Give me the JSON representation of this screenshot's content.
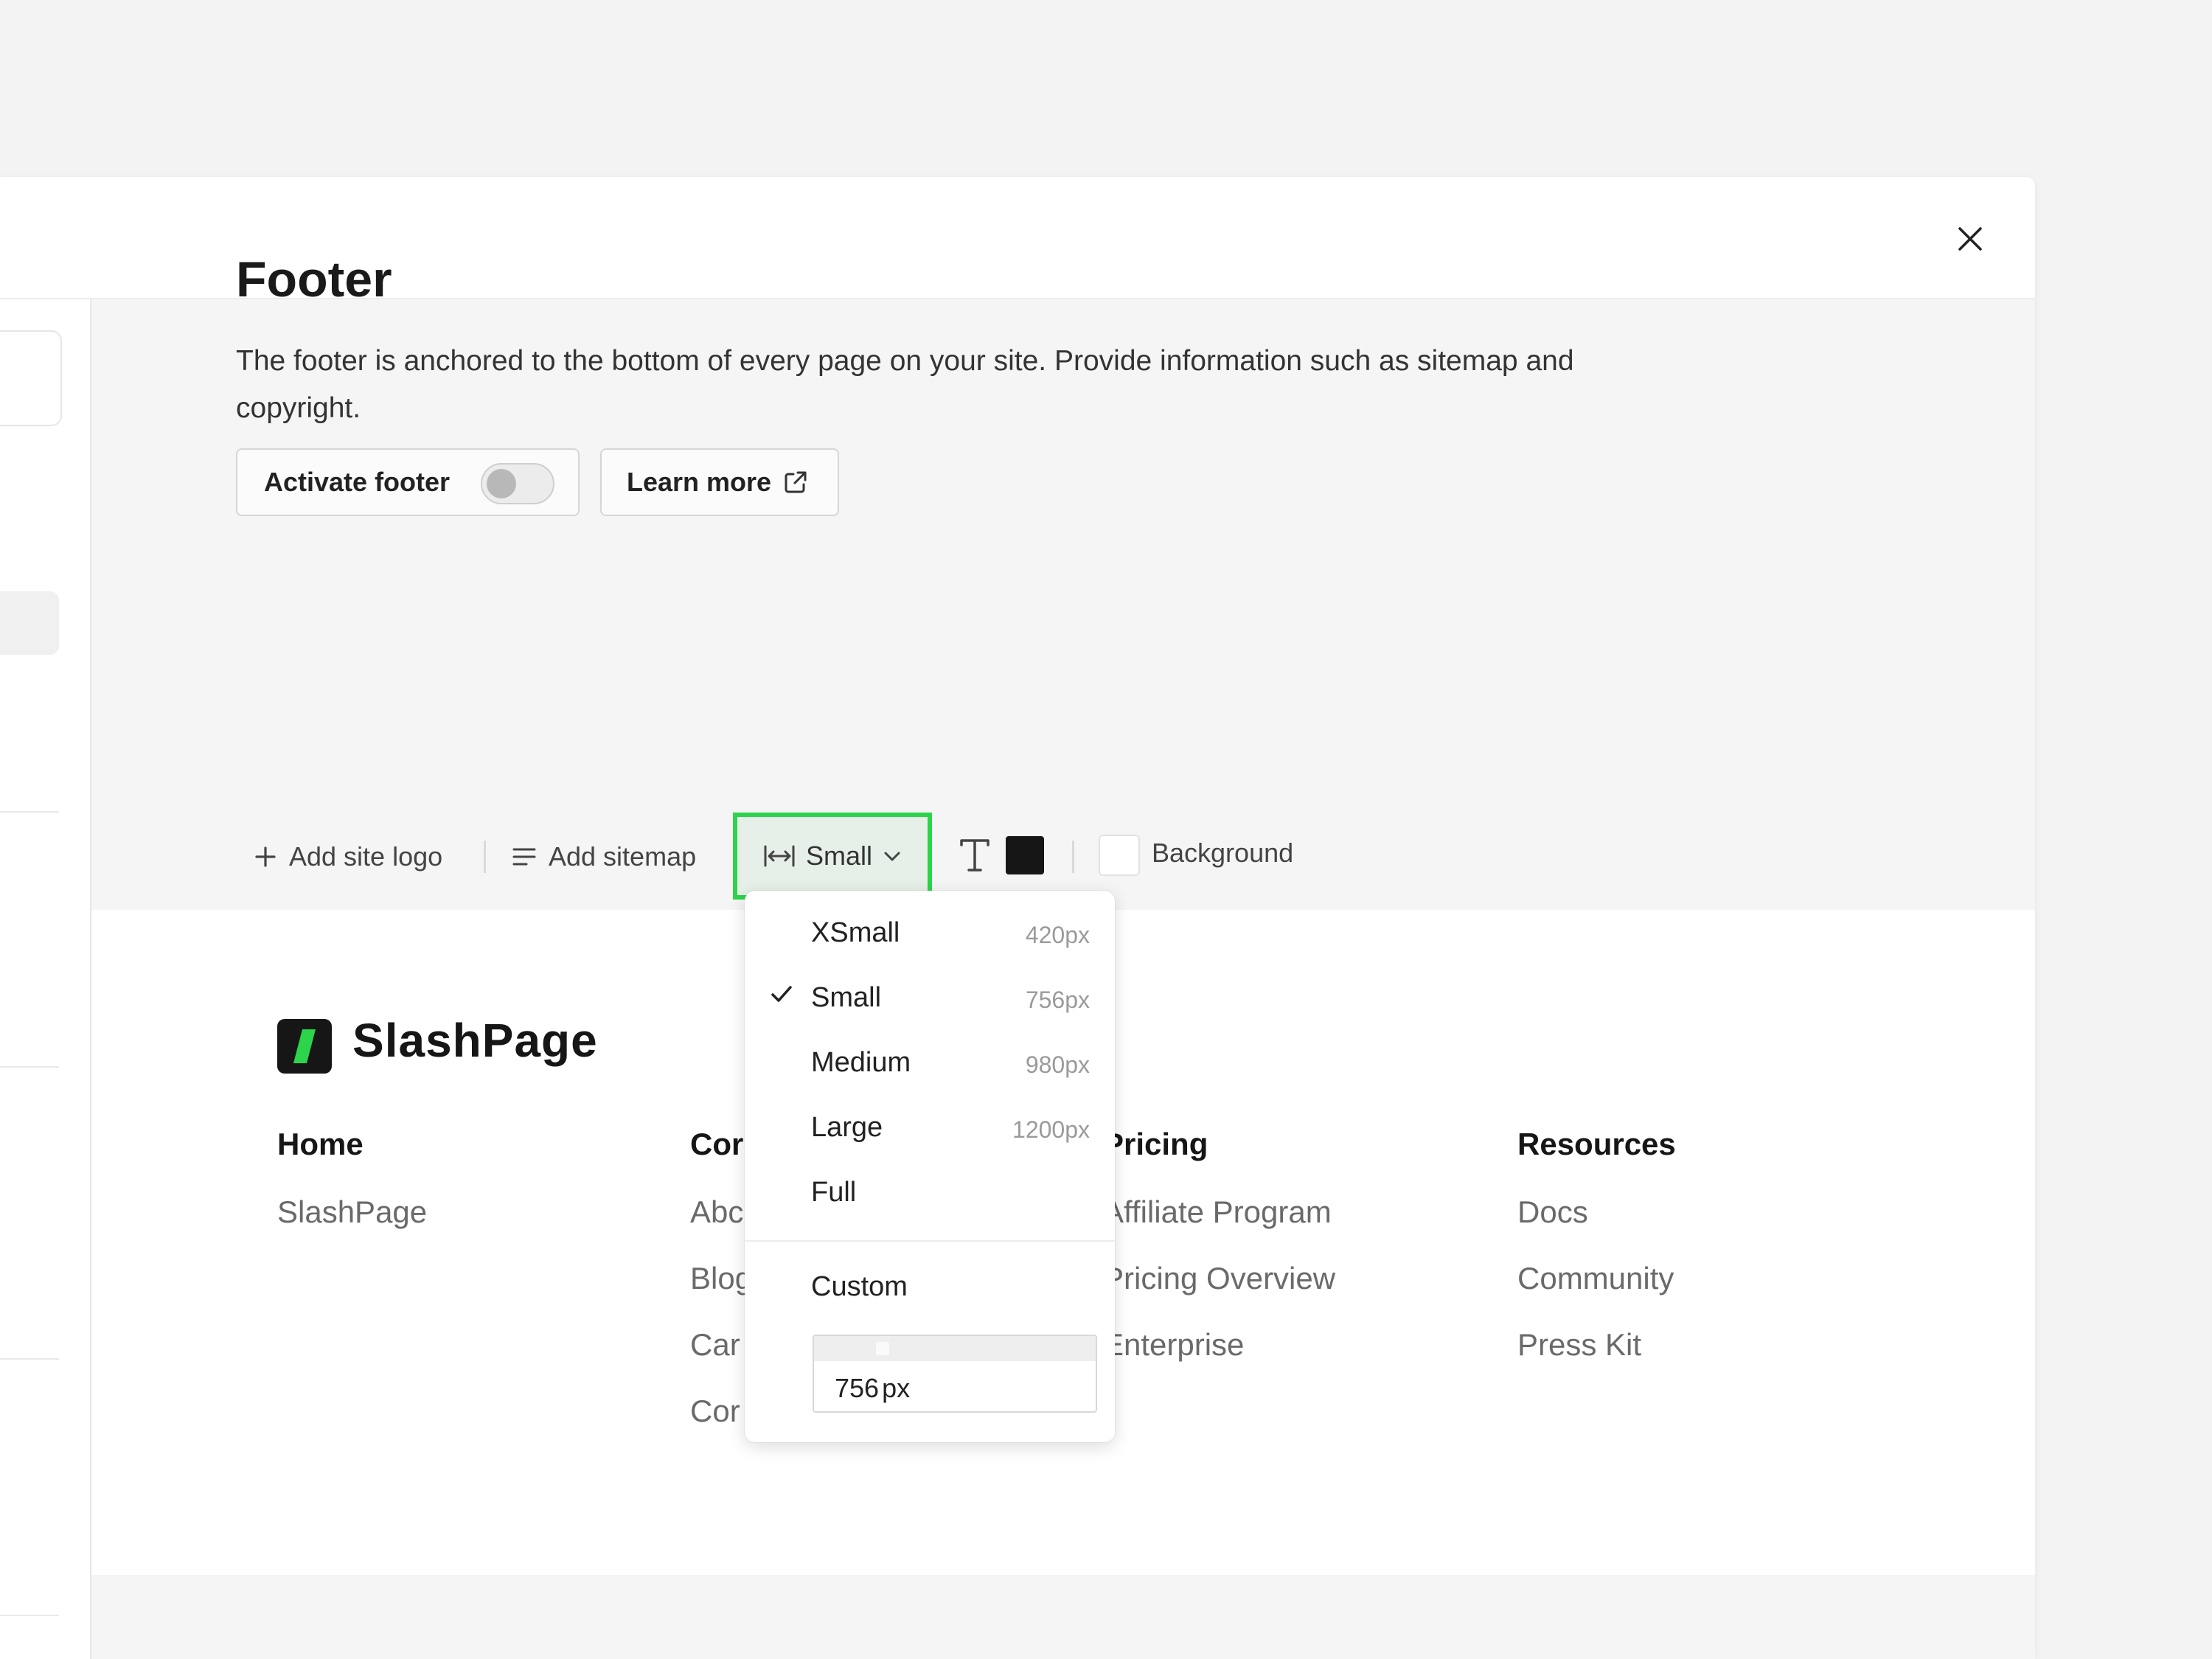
{
  "page": {
    "title": "Footer",
    "description": "The footer is anchored to the bottom of every page on your site. Provide information such as sitemap and copyright.",
    "activate_label": "Activate footer",
    "activate_on": false,
    "learn_more_label": "Learn more"
  },
  "toolbar": {
    "add_logo": "Add site logo",
    "add_sitemap": "Add sitemap",
    "size_label": "Small",
    "text_color": "#161616",
    "background_color": "#ffffff",
    "background_label": "Background"
  },
  "dropdown": {
    "items": [
      {
        "label": "XSmall",
        "px": "420px",
        "selected": false
      },
      {
        "label": "Small",
        "px": "756px",
        "selected": true
      },
      {
        "label": "Medium",
        "px": "980px",
        "selected": false
      },
      {
        "label": "Large",
        "px": "1200px",
        "selected": false
      },
      {
        "label": "Full",
        "px": "",
        "selected": false
      }
    ],
    "custom_label": "Custom",
    "custom_value": "756",
    "custom_unit": "px"
  },
  "preview": {
    "logo_text": "SlashPage",
    "columns": [
      {
        "heading": "Home",
        "links": [
          "SlashPage"
        ]
      },
      {
        "heading": "Cor",
        "links": [
          "Abc",
          "Blog",
          "Car",
          "Cor"
        ]
      },
      {
        "heading": "Pricing",
        "links": [
          "Affiliate Program",
          "Pricing Overview",
          "Enterprise"
        ]
      },
      {
        "heading": "Resources",
        "links": [
          "Docs",
          "Community",
          "Press Kit"
        ]
      }
    ]
  },
  "colors": {
    "accent": "#2bd44b",
    "logo_mark_slash": "#2bd44b"
  }
}
